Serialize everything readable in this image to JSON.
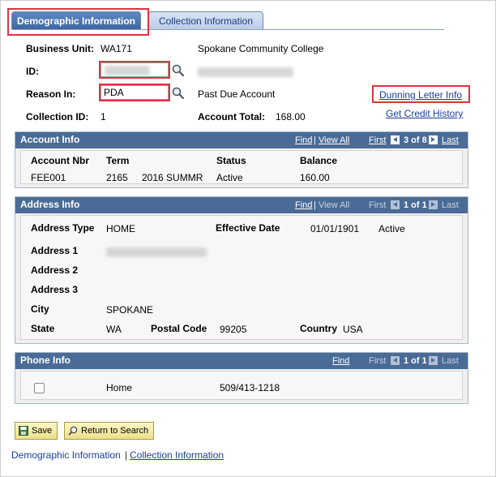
{
  "tabs": [
    {
      "label": "Demographic Information",
      "active": true
    },
    {
      "label": "Collection Information",
      "active": false
    }
  ],
  "header": {
    "business_unit_label": "Business Unit:",
    "business_unit_value": "WA171",
    "business_unit_desc": "Spokane Community College",
    "id_label": "ID:",
    "reason_label": "Reason In:",
    "reason_value": "PDA",
    "reason_desc": "Past Due Account",
    "dunning_link": "Dunning Letter Info",
    "credit_history_link": "Get Credit History",
    "collection_id_label": "Collection ID:",
    "collection_id_value": "1",
    "account_total_label": "Account Total:",
    "account_total_value": "168.00"
  },
  "account_info": {
    "title": "Account Info",
    "nav": {
      "find": "Find",
      "view_all": "View All",
      "first": "First",
      "count": "3 of 8",
      "last": "Last"
    },
    "columns": [
      "Account Nbr",
      "Term",
      "Status",
      "Balance"
    ],
    "row": {
      "account_nbr": "FEE001",
      "term_code": "2165",
      "term_desc": "2016 SUMMR",
      "status": "Active",
      "balance": "160.00"
    }
  },
  "address_info": {
    "title": "Address Info",
    "nav": {
      "find": "Find",
      "view_all": "View All",
      "first": "First",
      "count": "1 of 1",
      "last": "Last"
    },
    "address_type_label": "Address Type",
    "address_type_value": "HOME",
    "effective_date_label": "Effective Date",
    "effective_date_value": "01/01/1901",
    "status_value": "Active",
    "address1_label": "Address 1",
    "address2_label": "Address 2",
    "address3_label": "Address 3",
    "city_label": "City",
    "city_value": "SPOKANE",
    "state_label": "State",
    "state_value": "WA",
    "postal_label": "Postal Code",
    "postal_value": "99205",
    "country_label": "Country",
    "country_value": "USA"
  },
  "phone_info": {
    "title": "Phone Info",
    "nav": {
      "find": "Find",
      "first": "First",
      "count": "1 of 1",
      "last": "Last"
    },
    "type": "Home",
    "number": "509/413-1218"
  },
  "buttons": {
    "save": "Save",
    "return_to_search": "Return to Search"
  },
  "footer": {
    "link1": "Demographic Information",
    "separator": "|",
    "link2": "Collection Information"
  },
  "colors": {
    "highlight": "#d9363e",
    "group_header": "#4a6b96",
    "link": "#1a3d9c"
  },
  "icons": [
    "magnifier-icon",
    "save-icon",
    "return-search-icon",
    "nav-prev-icon",
    "nav-next-icon"
  ]
}
